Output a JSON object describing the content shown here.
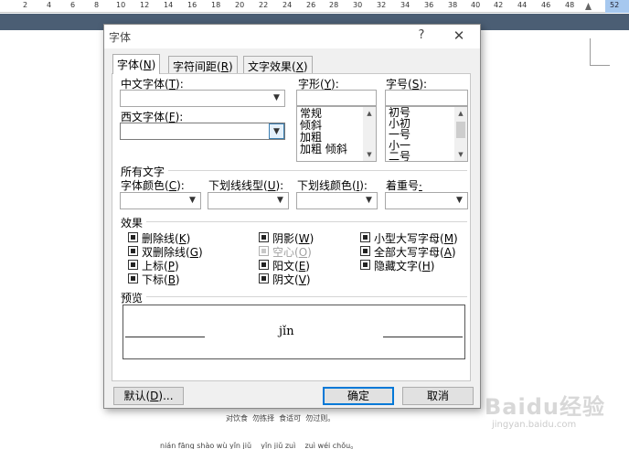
{
  "ruler": {
    "numbers": [
      "2",
      "4",
      "6",
      "8",
      "10",
      "12",
      "14",
      "16",
      "18",
      "20",
      "22",
      "24",
      "26",
      "28",
      "30",
      "32",
      "34",
      "36",
      "38",
      "40",
      "42",
      "44",
      "46",
      "48"
    ],
    "end_number": "52"
  },
  "document": {
    "line1": "对饮食  勿拣择  食适可  勿过则。",
    "line2": "nián fāng shào wù yǐn jiǔ    yǐn jiǔ zuì    zuì wéi chǒu。"
  },
  "watermark": {
    "brand": "Baidu经验",
    "url": "jingyan.baidu.com"
  },
  "dialog": {
    "title": "字体",
    "help_glyph": "?",
    "close_glyph": "✕",
    "tabs": [
      {
        "label": "字体(",
        "key": "N",
        "suffix": ")"
      },
      {
        "label": "字符间距(",
        "key": "R",
        "suffix": ")"
      },
      {
        "label": "文字效果(",
        "key": "X",
        "suffix": ")"
      }
    ],
    "chinese_font": {
      "label": "中文字体(",
      "key": "T",
      "suffix": "):",
      "value": ""
    },
    "western_font": {
      "label": "西文字体(",
      "key": "F",
      "suffix": "):",
      "value": ""
    },
    "style": {
      "label": "字形(",
      "key": "Y",
      "suffix": "):",
      "value": "",
      "options": [
        "常规",
        "倾斜",
        "加粗",
        "加粗 倾斜"
      ]
    },
    "size": {
      "label": "字号(",
      "key": "S",
      "suffix": "):",
      "value": "",
      "options": [
        "初号",
        "小初",
        "一号",
        "小一",
        "二号"
      ]
    },
    "all_text_label": "所有文字",
    "font_color": {
      "label": "字体颜色(",
      "key": "C",
      "suffix": "):"
    },
    "underline_style": {
      "label": "下划线线型(",
      "key": "U",
      "suffix": "):"
    },
    "underline_color": {
      "label": "下划线颜色(",
      "key": "I",
      "suffix": "):"
    },
    "emphasis": {
      "label": "着重号",
      "key": "·"
    },
    "effects_label": "效果",
    "effects": [
      {
        "label": "删除线(",
        "key": "K",
        "suffix": ")",
        "disabled": false
      },
      {
        "label": "双删除线(",
        "key": "G",
        "suffix": ")",
        "disabled": false
      },
      {
        "label": "上标(",
        "key": "P",
        "suffix": ")",
        "disabled": false
      },
      {
        "label": "下标(",
        "key": "B",
        "suffix": ")",
        "disabled": false
      },
      {
        "label": "阴影(",
        "key": "W",
        "suffix": ")",
        "disabled": false
      },
      {
        "label": "空心(",
        "key": "O",
        "suffix": ")",
        "disabled": true
      },
      {
        "label": "阳文(",
        "key": "E",
        "suffix": ")",
        "disabled": false
      },
      {
        "label": "阴文(",
        "key": "V",
        "suffix": ")",
        "disabled": false
      },
      {
        "label": "小型大写字母(",
        "key": "M",
        "suffix": ")",
        "disabled": false
      },
      {
        "label": "全部大写字母(",
        "key": "A",
        "suffix": ")",
        "disabled": false
      },
      {
        "label": "隐藏文字(",
        "key": "H",
        "suffix": ")",
        "disabled": false
      }
    ],
    "preview_label": "预览",
    "preview_text": "jǐn",
    "buttons": {
      "default": {
        "label": "默认(",
        "key": "D",
        "suffix": ")..."
      },
      "ok": "确定",
      "cancel": "取消"
    }
  }
}
